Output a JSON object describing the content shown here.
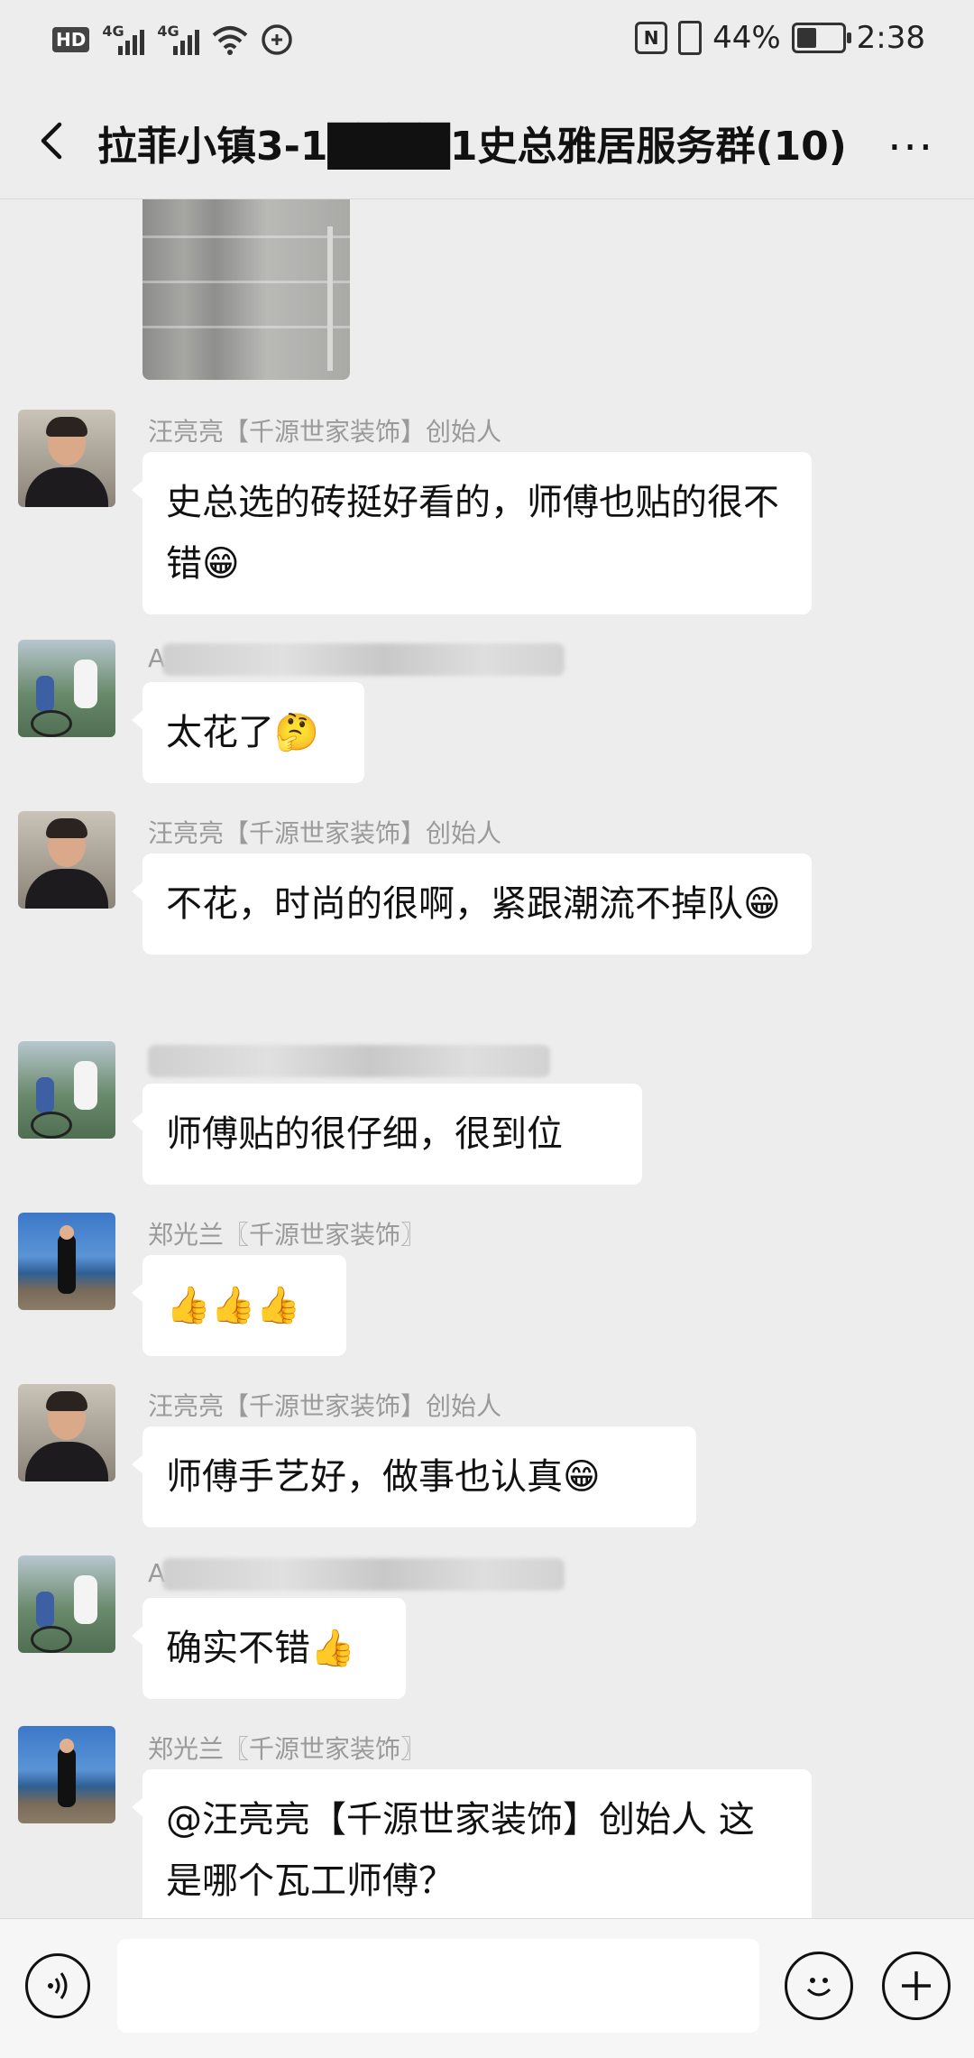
{
  "status_bar": {
    "hd_label": "HD",
    "signal1_label": "4G",
    "signal2_label": "4G",
    "battery_percent": "44%",
    "battery_level": 0.44,
    "time": "2:38"
  },
  "header": {
    "title": "拉菲小镇3-1████1史总雅居服务群(10)",
    "more_icon": "more-dots-icon",
    "back_icon": "back-arrow-icon"
  },
  "messages": [
    {
      "sender": "汪亮亮【千源世家装饰】创始人",
      "text": "史总选的砖挺好看的，师傅也贴的很不错😁"
    },
    {
      "sender": "A",
      "text": "太花了🤔"
    },
    {
      "sender": "汪亮亮【千源世家装饰】创始人",
      "text": "不花，时尚的很啊，紧跟潮流不掉队😁"
    },
    {
      "sender": "",
      "text": "师傅贴的很仔细，很到位"
    },
    {
      "sender": "郑光兰〖千源世家装饰〗",
      "text": "👍👍👍"
    },
    {
      "sender": "汪亮亮【千源世家装饰】创始人",
      "text": "师傅手艺好，做事也认真😁"
    },
    {
      "sender": "A",
      "text": "确实不错👍"
    },
    {
      "sender": "郑光兰〖千源世家装饰〗",
      "text": "@汪亮亮【千源世家装饰】创始人 这是哪个瓦工师傅？"
    }
  ],
  "bottom_bar": {
    "voice_icon": "voice-icon",
    "emoji_icon": "emoji-icon",
    "plus_icon": "plus-icon",
    "input_value": ""
  }
}
